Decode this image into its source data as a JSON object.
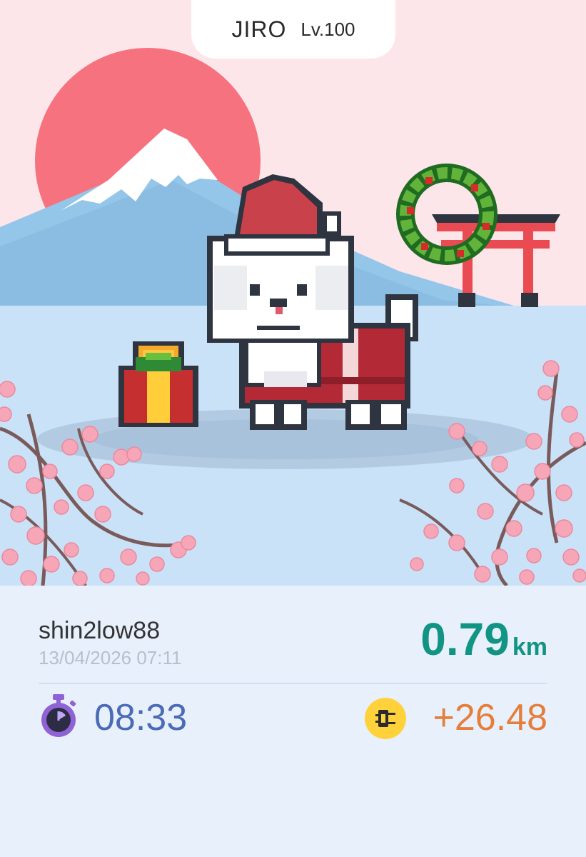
{
  "pet": {
    "name": "JIRO",
    "level": "Lv.100"
  },
  "activity": {
    "username": "shin2low88",
    "timestamp": "13/04/2026 07:11",
    "distance_value": "0.79",
    "distance_unit": "km",
    "duration": "08:33",
    "earnings": "+26.48"
  },
  "icons": {
    "timer": "stopwatch-icon",
    "token": "energy-token-icon"
  },
  "colors": {
    "distance": "#119483",
    "duration": "#4a6bb5",
    "earnings": "#e57e3a",
    "sky": "#fde6e9",
    "water": "#c9e2f7"
  }
}
